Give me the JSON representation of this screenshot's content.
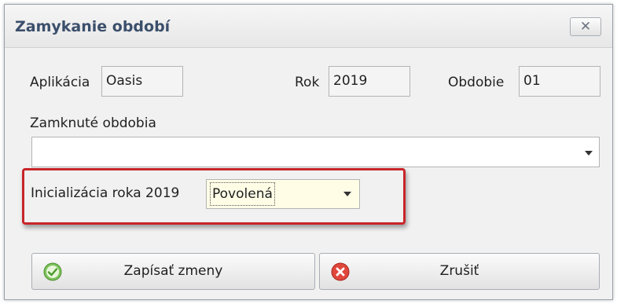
{
  "dialog": {
    "title": "Zamykanie období",
    "close_label": "✕"
  },
  "form": {
    "application_label": "Aplikácia",
    "application_value": "Oasis",
    "year_label": "Rok",
    "year_value": "2019",
    "period_label": "Obdobie",
    "period_value": "01",
    "locked_periods_label": "Zamknuté obdobia",
    "locked_periods_value": "",
    "year_init_label": "Inicializácia roka 2019",
    "year_init_value": "Povolená"
  },
  "buttons": {
    "save_label": "Zapísať zmeny",
    "cancel_label": "Zrušiť"
  },
  "colors": {
    "title_text": "#3b4f6b",
    "highlight_border": "#c8252a",
    "status_bg": "#fffde6",
    "save_icon": "#6ab04c",
    "cancel_icon": "#d9342b"
  },
  "icons": {
    "save": "check-circle-icon",
    "cancel": "cancel-circle-icon",
    "close": "close-icon"
  }
}
